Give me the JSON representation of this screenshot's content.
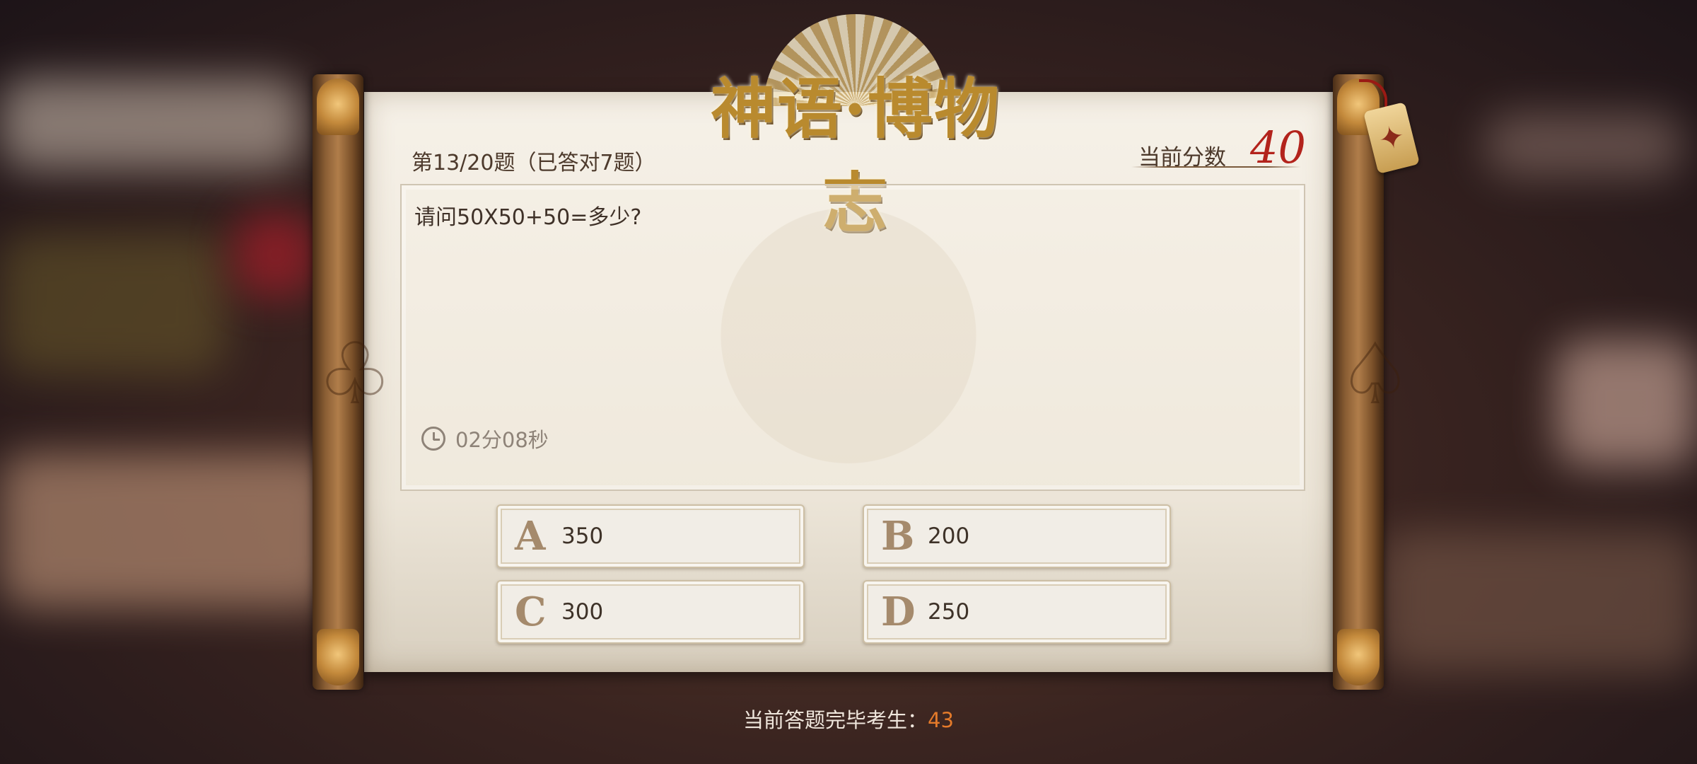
{
  "header": {
    "title": "神语·博物志"
  },
  "quiz": {
    "progress": "第13/20题（已答对7题）",
    "score_label": "当前分数",
    "score_value": "40",
    "question": "请问50X50+50=多少?",
    "timer": "02分08秒"
  },
  "options": [
    {
      "letter": "A",
      "value": "350"
    },
    {
      "letter": "B",
      "value": "200"
    },
    {
      "letter": "C",
      "value": "300"
    },
    {
      "letter": "D",
      "value": "250"
    }
  ],
  "footer": {
    "label": "当前答题完毕考生：",
    "count": "43"
  },
  "colors": {
    "score": "#b3231c",
    "count": "#e47a2a",
    "title": "#b98a2e"
  },
  "icons": [
    "clock-icon",
    "star-tag-icon"
  ]
}
